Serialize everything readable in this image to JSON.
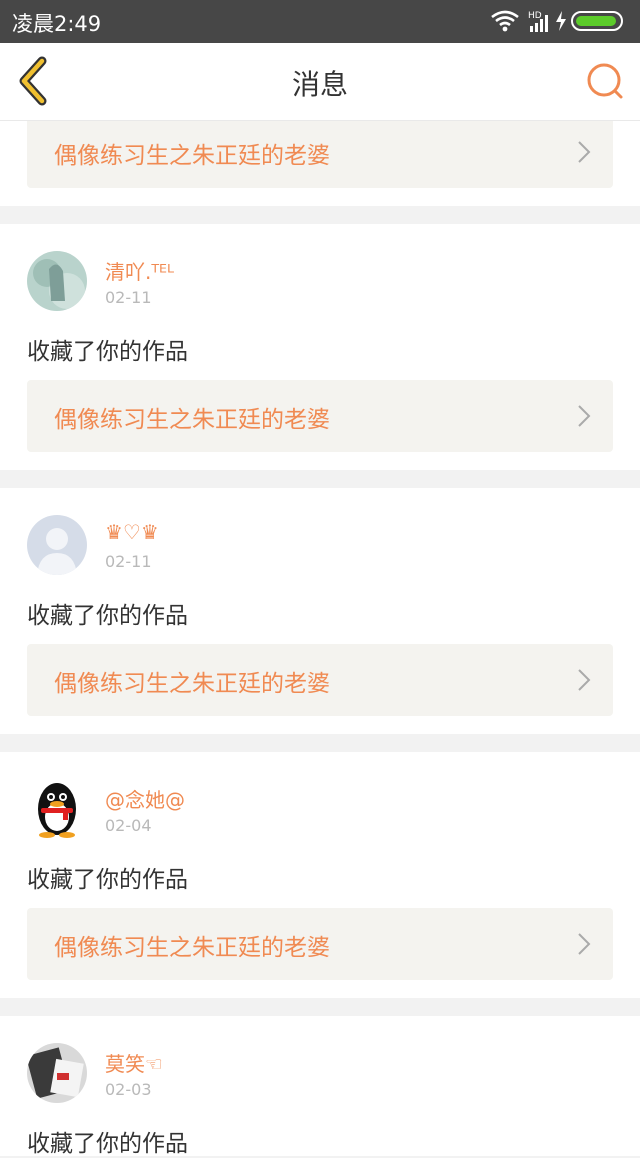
{
  "status": {
    "time": "凌晨2:49",
    "network": "HD"
  },
  "navbar": {
    "title": "消息"
  },
  "top_card": {
    "work_title": "偶像练习生之朱正廷的老婆"
  },
  "messages": [
    {
      "username": "清吖.ᵀᴱᴸ",
      "date": "02-11",
      "action": "收藏了你的作品",
      "work_title": "偶像练习生之朱正廷的老婆",
      "avatar": "photo-avatar"
    },
    {
      "username": "♛♡♛",
      "date": "02-11",
      "action": "收藏了你的作品",
      "work_title": "偶像练习生之朱正廷的老婆",
      "avatar": "default-person-avatar"
    },
    {
      "username": "@念她@",
      "date": "02-04",
      "action": "收藏了你的作品",
      "work_title": "偶像练习生之朱正廷的老婆",
      "avatar": "qq-penguin-avatar"
    },
    {
      "username": "莫笑☜",
      "date": "02-03",
      "action": "收藏了你的作品",
      "work_title": "",
      "avatar": "photo-avatar"
    }
  ],
  "colors": {
    "accent": "#f08a52",
    "status_bar": "#474747",
    "battery": "#5ccb2a",
    "back_arrow": "#f0c030"
  }
}
